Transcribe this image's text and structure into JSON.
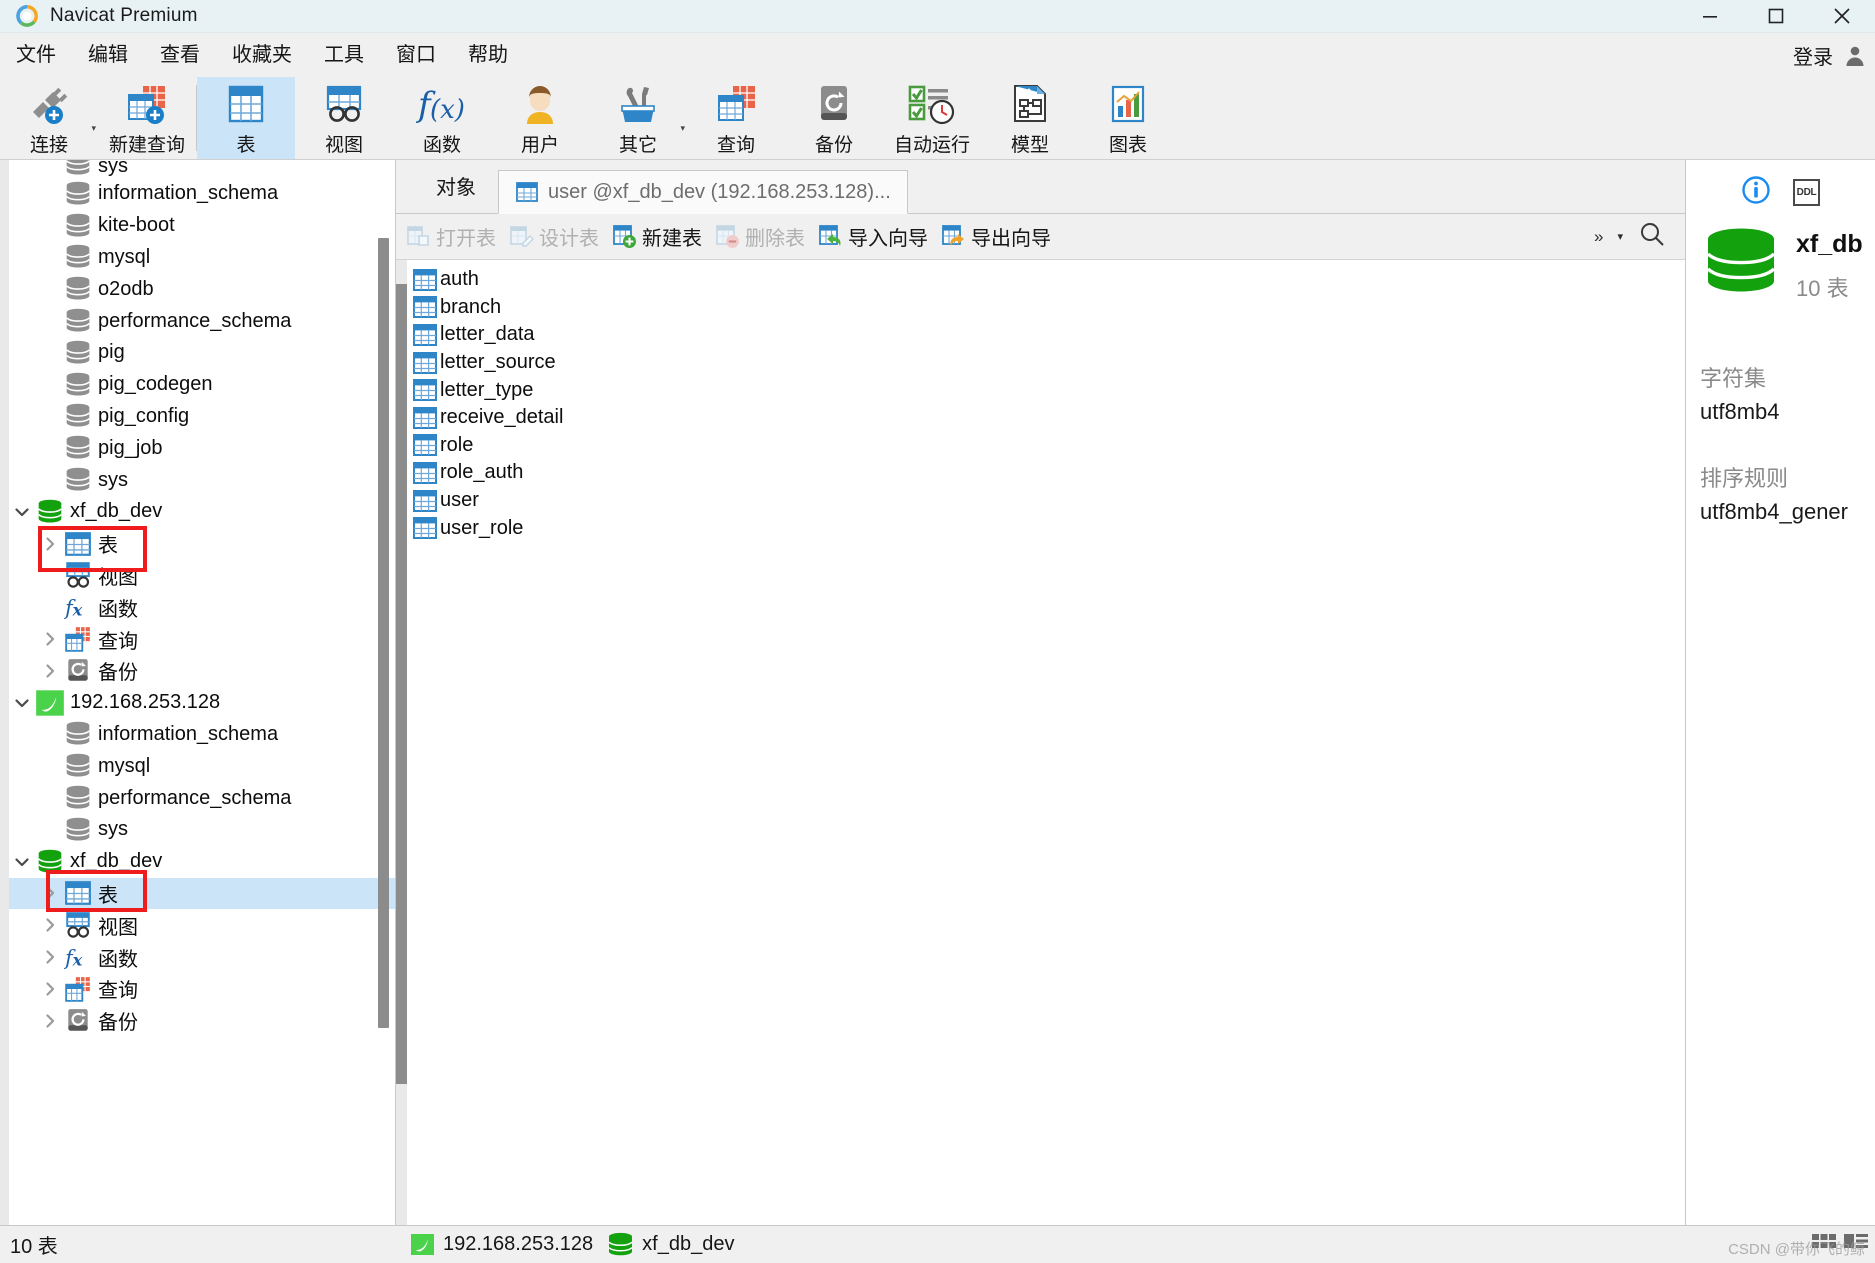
{
  "window": {
    "title": "Navicat Premium",
    "logo_icon": "navicat-logo-icon",
    "minimize_icon": "minimize-icon",
    "maximize_icon": "maximize-icon",
    "close_icon": "close-icon"
  },
  "menubar": {
    "items": [
      {
        "label": "文件"
      },
      {
        "label": "编辑"
      },
      {
        "label": "查看"
      },
      {
        "label": "收藏夹"
      },
      {
        "label": "工具"
      },
      {
        "label": "窗口"
      },
      {
        "label": "帮助"
      }
    ],
    "login_label": "登录",
    "login_icon": "user-avatar-icon"
  },
  "toolbar": {
    "items": [
      {
        "label": "连接",
        "icon": "connection-plug-icon",
        "active": false,
        "caret": true
      },
      {
        "label": "新建查询",
        "icon": "new-query-icon",
        "active": false,
        "caret": false
      },
      {
        "label": "表",
        "icon": "table-icon",
        "active": true,
        "caret": false
      },
      {
        "label": "视图",
        "icon": "view-icon",
        "active": false,
        "caret": false
      },
      {
        "label": "函数",
        "icon": "function-fx-icon",
        "active": false,
        "caret": false
      },
      {
        "label": "用户",
        "icon": "user-icon",
        "active": false,
        "caret": false
      },
      {
        "label": "其它",
        "icon": "other-tools-icon",
        "active": false,
        "caret": true
      },
      {
        "label": "查询",
        "icon": "query-icon",
        "active": false,
        "caret": false
      },
      {
        "label": "备份",
        "icon": "backup-icon",
        "active": false,
        "caret": false
      },
      {
        "label": "自动运行",
        "icon": "automation-icon",
        "active": false,
        "caret": false
      },
      {
        "label": "模型",
        "icon": "model-icon",
        "active": false,
        "caret": false
      },
      {
        "label": "图表",
        "icon": "chart-icon",
        "active": false,
        "caret": false
      }
    ]
  },
  "tree": {
    "rows": [
      {
        "label": "sys",
        "icon": "db-gray-icon",
        "indent": 1,
        "twisty": "none",
        "clipped": true,
        "selected": false
      },
      {
        "label": "information_schema",
        "icon": "db-gray-icon",
        "indent": 1,
        "twisty": "none",
        "selected": false
      },
      {
        "label": "kite-boot",
        "icon": "db-gray-icon",
        "indent": 1,
        "twisty": "none",
        "selected": false
      },
      {
        "label": "mysql",
        "icon": "db-gray-icon",
        "indent": 1,
        "twisty": "none",
        "selected": false
      },
      {
        "label": "o2odb",
        "icon": "db-gray-icon",
        "indent": 1,
        "twisty": "none",
        "selected": false
      },
      {
        "label": "performance_schema",
        "icon": "db-gray-icon",
        "indent": 1,
        "twisty": "none",
        "selected": false
      },
      {
        "label": "pig",
        "icon": "db-gray-icon",
        "indent": 1,
        "twisty": "none",
        "selected": false
      },
      {
        "label": "pig_codegen",
        "icon": "db-gray-icon",
        "indent": 1,
        "twisty": "none",
        "selected": false
      },
      {
        "label": "pig_config",
        "icon": "db-gray-icon",
        "indent": 1,
        "twisty": "none",
        "selected": false
      },
      {
        "label": "pig_job",
        "icon": "db-gray-icon",
        "indent": 1,
        "twisty": "none",
        "selected": false
      },
      {
        "label": "sys",
        "icon": "db-gray-icon",
        "indent": 1,
        "twisty": "none",
        "selected": false
      },
      {
        "label": "xf_db_dev",
        "icon": "db-green-icon",
        "indent": 0,
        "twisty": "expanded",
        "selected": false
      },
      {
        "label": "表",
        "icon": "table-icon",
        "indent": 1,
        "twisty": "collapsed",
        "selected": false
      },
      {
        "label": "视图",
        "icon": "view-icon",
        "indent": 1,
        "twisty": "none",
        "selected": false
      },
      {
        "label": "函数",
        "icon": "function-fx-icon",
        "indent": 1,
        "twisty": "none",
        "selected": false
      },
      {
        "label": "查询",
        "icon": "query-icon",
        "indent": 1,
        "twisty": "collapsed",
        "selected": false
      },
      {
        "label": "备份",
        "icon": "backup-icon",
        "indent": 1,
        "twisty": "collapsed",
        "selected": false
      },
      {
        "label": "192.168.253.128",
        "icon": "mysql-conn-icon",
        "indent": 0,
        "twisty": "expanded",
        "root": true,
        "selected": false
      },
      {
        "label": "information_schema",
        "icon": "db-gray-icon",
        "indent": 1,
        "twisty": "none",
        "selected": false
      },
      {
        "label": "mysql",
        "icon": "db-gray-icon",
        "indent": 1,
        "twisty": "none",
        "selected": false
      },
      {
        "label": "performance_schema",
        "icon": "db-gray-icon",
        "indent": 1,
        "twisty": "none",
        "selected": false
      },
      {
        "label": "sys",
        "icon": "db-gray-icon",
        "indent": 1,
        "twisty": "none",
        "selected": false
      },
      {
        "label": "xf_db_dev",
        "icon": "db-green-icon",
        "indent": 0,
        "twisty": "expanded",
        "selected": false
      },
      {
        "label": "表",
        "icon": "table-icon",
        "indent": 1,
        "twisty": "collapsed",
        "selected": true
      },
      {
        "label": "视图",
        "icon": "view-icon",
        "indent": 1,
        "twisty": "collapsed",
        "selected": false
      },
      {
        "label": "函数",
        "icon": "function-fx-icon",
        "indent": 1,
        "twisty": "collapsed",
        "selected": false
      },
      {
        "label": "查询",
        "icon": "query-icon",
        "indent": 1,
        "twisty": "collapsed",
        "selected": false
      },
      {
        "label": "备份",
        "icon": "backup-icon",
        "indent": 1,
        "twisty": "collapsed",
        "selected": false
      }
    ]
  },
  "main": {
    "object_tab_label": "对象",
    "document_tab": {
      "label": "user @xf_db_dev (192.168.253.128)...",
      "icon": "table-icon"
    },
    "actions": [
      {
        "label": "打开表",
        "icon": "open-table-icon",
        "disabled": true
      },
      {
        "label": "设计表",
        "icon": "design-table-icon",
        "disabled": true
      },
      {
        "label": "新建表",
        "icon": "new-table-icon",
        "disabled": false
      },
      {
        "label": "删除表",
        "icon": "delete-table-icon",
        "disabled": true
      },
      {
        "label": "导入向导",
        "icon": "import-wizard-icon",
        "disabled": false
      },
      {
        "label": "导出向导",
        "icon": "export-wizard-icon",
        "disabled": false
      }
    ],
    "more_icon": "chevron-double-right-icon",
    "dropdown_icon": "caret-down-icon",
    "search_icon": "search-icon",
    "tables": [
      {
        "name": "auth",
        "icon": "table-icon"
      },
      {
        "name": "branch",
        "icon": "table-icon"
      },
      {
        "name": "letter_data",
        "icon": "table-icon"
      },
      {
        "name": "letter_source",
        "icon": "table-icon"
      },
      {
        "name": "letter_type",
        "icon": "table-icon"
      },
      {
        "name": "receive_detail",
        "icon": "table-icon"
      },
      {
        "name": "role",
        "icon": "table-icon"
      },
      {
        "name": "role_auth",
        "icon": "table-icon"
      },
      {
        "name": "user",
        "icon": "table-icon"
      },
      {
        "name": "user_role",
        "icon": "table-icon"
      }
    ]
  },
  "info_panel": {
    "info_icon": "info-circle-icon",
    "ddl_label": "DDL",
    "db_icon": "db-green-icon",
    "db_name": "xf_db",
    "table_count": "10 表",
    "fields": [
      {
        "key": "字符集",
        "value": "utf8mb4"
      },
      {
        "key": "排序规则",
        "value": "utf8mb4_gener"
      }
    ]
  },
  "statusbar": {
    "left_text": "10 表",
    "connection": {
      "label": "192.168.253.128",
      "icon": "mysql-conn-icon"
    },
    "database": {
      "label": "xf_db_dev",
      "icon": "db-green-icon"
    },
    "watermark": "CSDN @带你飞的鲸"
  },
  "colors": {
    "accent_blue": "#1a7ec8",
    "selection": "#cce4f7",
    "annotation_red": "#ee1c1c",
    "db_green": "#13a10e",
    "chrome": "#f0f0f0"
  }
}
